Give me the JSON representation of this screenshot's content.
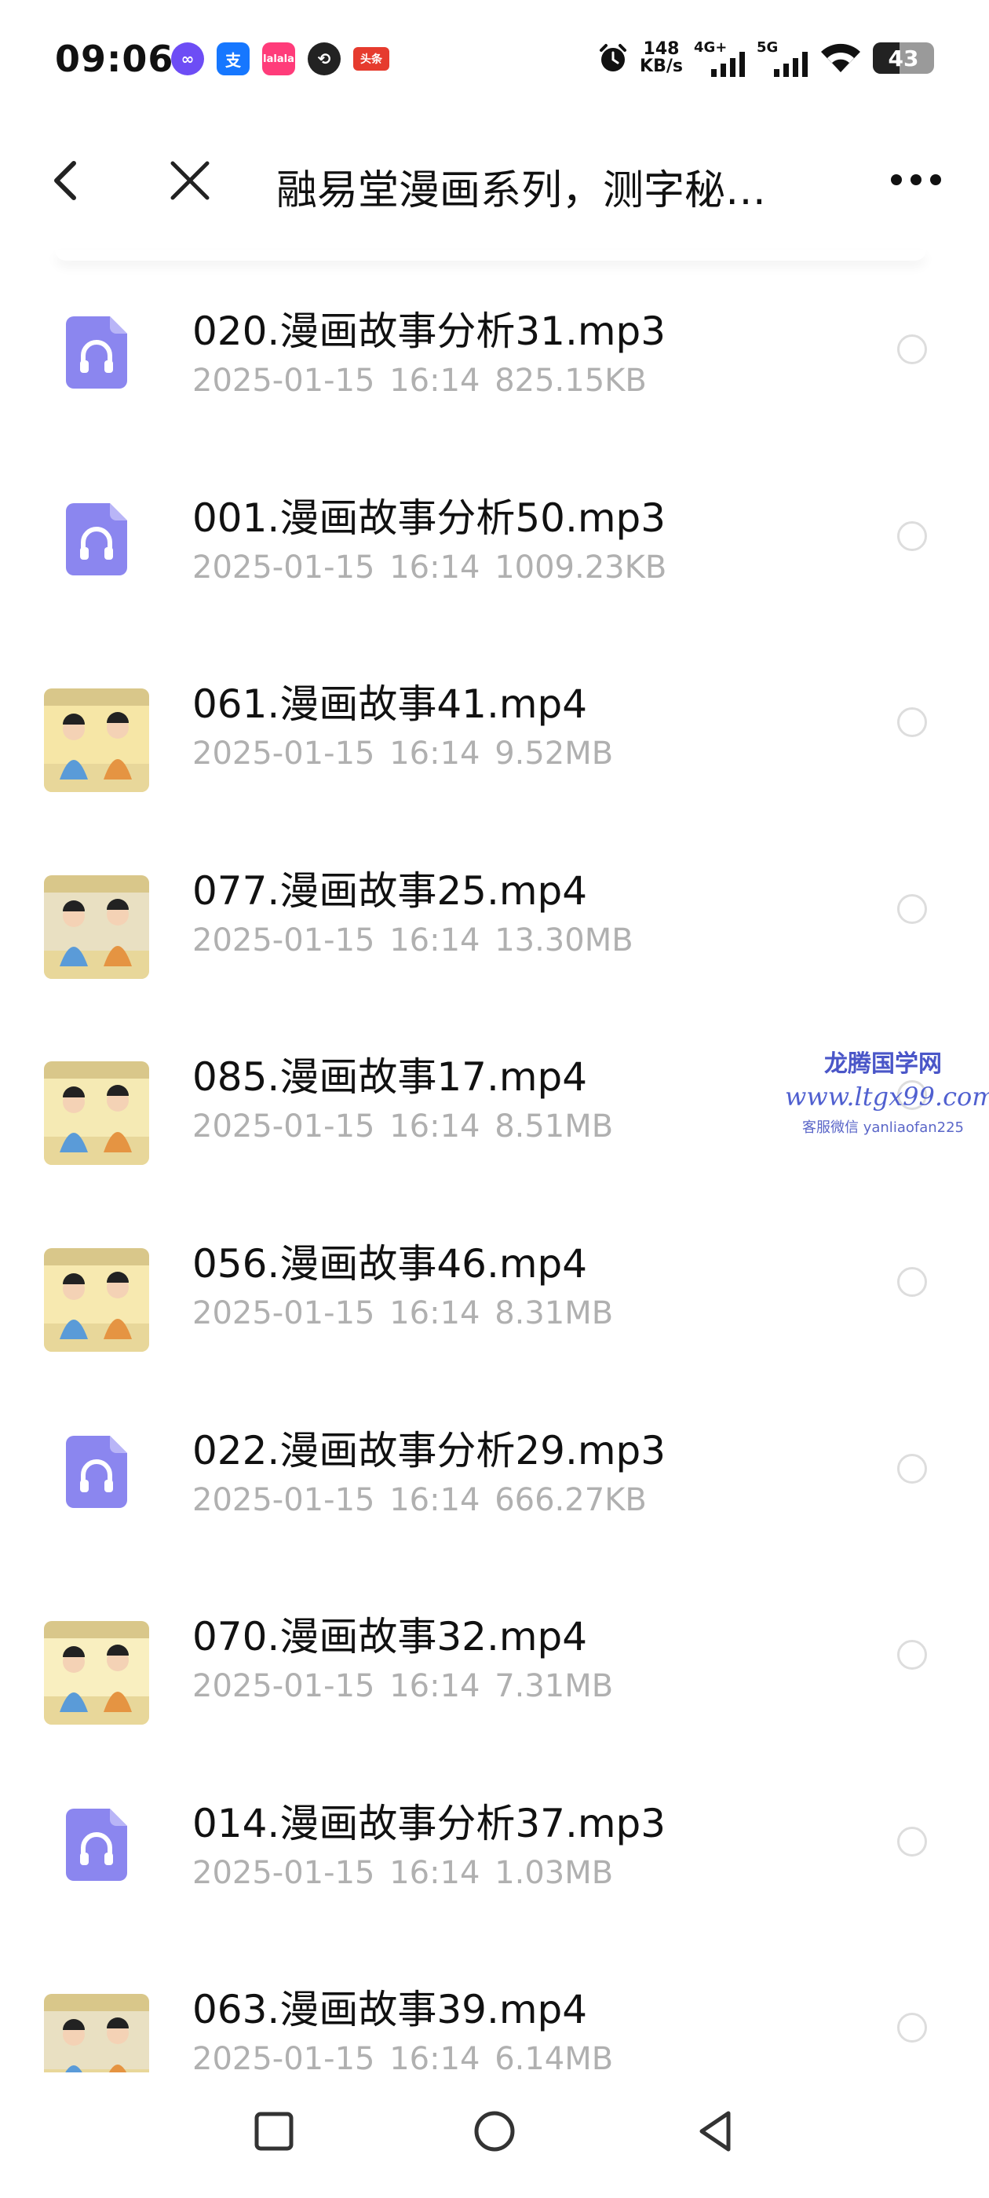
{
  "status_bar": {
    "time": "09:06",
    "app_icons": [
      {
        "name": "infinity-app-icon",
        "glyph": "∞"
      },
      {
        "name": "alipay-app-icon",
        "glyph": "支"
      },
      {
        "name": "pink-app-icon",
        "glyph": "lalala"
      },
      {
        "name": "swirl-app-icon",
        "glyph": "⟲"
      },
      {
        "name": "toutiao-app-icon",
        "glyph": "头条"
      }
    ],
    "speed_value": "148",
    "speed_unit": "KB/s",
    "network_1": "4G+",
    "network_2": "5G",
    "battery": "43",
    "battery_level": 0.43
  },
  "title_bar": {
    "title": "融易堂漫画系列，测字秘…"
  },
  "files": [
    {
      "type": "audio",
      "name": "020.漫画故事分析31.mp3",
      "date": "2025-01-15",
      "time": "16:14",
      "size": "825.15KB"
    },
    {
      "type": "audio",
      "name": "001.漫画故事分析50.mp3",
      "date": "2025-01-15",
      "time": "16:14",
      "size": "1009.23KB"
    },
    {
      "type": "video",
      "name": "061.漫画故事41.mp4",
      "date": "2025-01-15",
      "time": "16:14",
      "size": "9.52MB"
    },
    {
      "type": "video",
      "name": "077.漫画故事25.mp4",
      "date": "2025-01-15",
      "time": "16:14",
      "size": "13.30MB"
    },
    {
      "type": "video",
      "name": "085.漫画故事17.mp4",
      "date": "2025-01-15",
      "time": "16:14",
      "size": "8.51MB"
    },
    {
      "type": "video",
      "name": "056.漫画故事46.mp4",
      "date": "2025-01-15",
      "time": "16:14",
      "size": "8.31MB"
    },
    {
      "type": "audio",
      "name": "022.漫画故事分析29.mp3",
      "date": "2025-01-15",
      "time": "16:14",
      "size": "666.27KB"
    },
    {
      "type": "video",
      "name": "070.漫画故事32.mp4",
      "date": "2025-01-15",
      "time": "16:14",
      "size": "7.31MB"
    },
    {
      "type": "audio",
      "name": "014.漫画故事分析37.mp3",
      "date": "2025-01-15",
      "time": "16:14",
      "size": "1.03MB"
    },
    {
      "type": "video",
      "name": "063.漫画故事39.mp4",
      "date": "2025-01-15",
      "time": "16:14",
      "size": "6.14MB"
    }
  ],
  "watermark": {
    "line1": "龙腾国学网",
    "line2": "www.ltgx99.com",
    "line3": "客服微信 yanliaofan225"
  },
  "colors": {
    "audio_icon": "#8b86ef",
    "meta_text": "#b0b0b0",
    "radio_border": "#dddddd",
    "video_thumb_bg": "#f6e9a8"
  }
}
